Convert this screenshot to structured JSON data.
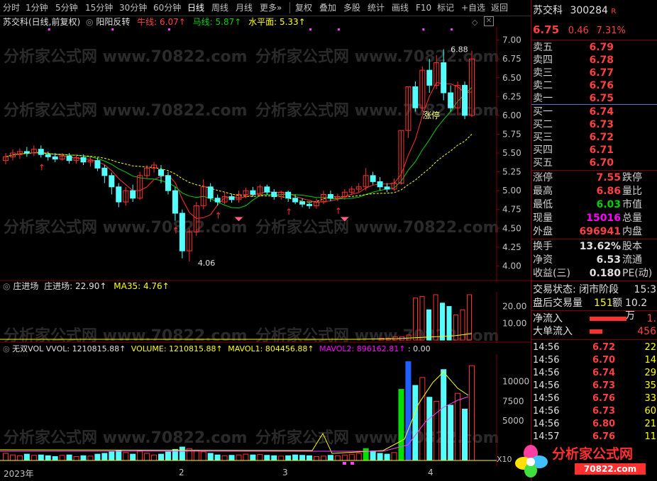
{
  "toolbar": {
    "items": [
      "分时",
      "1分钟",
      "5分钟",
      "15分钟",
      "30分钟",
      "60分钟",
      "日线",
      "周线",
      "月线",
      "更多»",
      "复权",
      "叠加",
      "多股",
      "统计",
      "画线",
      "F10",
      "标记",
      "+自选",
      "返回"
    ],
    "active": "日线"
  },
  "main_chart": {
    "title": "苏交科(日线,前复权)",
    "indicator_name": "阳阳反转",
    "niu_label": "牛线: 6.07↑",
    "ma_label": "马线: 5.87↑",
    "water_label": "水平面: 5.33↑",
    "y_ticks": [
      "7.00",
      "6.75",
      "6.50",
      "6.25",
      "6.00",
      "5.75",
      "5.50",
      "5.25",
      "5.00",
      "4.75",
      "4.50",
      "4.25",
      "4.00"
    ],
    "max_label": "6.88",
    "min_label": "4.06",
    "zhangting_label": "涨停",
    "candles": [
      [
        5.4,
        5.45,
        5.35,
        5.5
      ],
      [
        5.45,
        5.5,
        5.4,
        5.55
      ],
      [
        5.48,
        5.52,
        5.42,
        5.56
      ],
      [
        5.52,
        5.5,
        5.45,
        5.58
      ],
      [
        5.5,
        5.55,
        5.46,
        5.6
      ],
      [
        5.55,
        5.48,
        5.44,
        5.6
      ],
      [
        5.48,
        5.45,
        5.4,
        5.52
      ],
      [
        5.45,
        5.42,
        5.38,
        5.5
      ],
      [
        5.42,
        5.46,
        5.4,
        5.5
      ],
      [
        5.46,
        5.4,
        5.36,
        5.5
      ],
      [
        5.4,
        5.44,
        5.36,
        5.48
      ],
      [
        5.44,
        5.38,
        5.34,
        5.48
      ],
      [
        5.38,
        5.4,
        5.32,
        5.45
      ],
      [
        5.4,
        5.3,
        5.26,
        5.44
      ],
      [
        5.3,
        5.2,
        5.1,
        5.34
      ],
      [
        5.2,
        5.05,
        4.95,
        5.24
      ],
      [
        5.05,
        4.85,
        4.78,
        5.1
      ],
      [
        4.85,
        5.0,
        4.8,
        5.05
      ],
      [
        5.0,
        4.9,
        4.85,
        5.08
      ],
      [
        4.9,
        5.2,
        4.88,
        5.25
      ],
      [
        5.2,
        5.3,
        5.16,
        5.34
      ],
      [
        5.3,
        5.34,
        5.24,
        5.38
      ],
      [
        5.28,
        5.2,
        5.1,
        5.34
      ],
      [
        5.2,
        5.0,
        4.95,
        5.25
      ],
      [
        5.0,
        4.7,
        4.6,
        5.05
      ],
      [
        4.7,
        4.2,
        4.1,
        4.75
      ],
      [
        4.2,
        4.45,
        4.06,
        4.5
      ],
      [
        4.45,
        4.8,
        4.4,
        4.85
      ],
      [
        4.8,
        5.05,
        4.75,
        5.15
      ],
      [
        5.05,
        4.9,
        4.85,
        5.1
      ],
      [
        4.9,
        4.85,
        4.8,
        4.95
      ],
      [
        4.85,
        4.92,
        4.82,
        4.98
      ],
      [
        4.92,
        4.88,
        4.84,
        4.96
      ],
      [
        4.88,
        4.95,
        4.84,
        5.0
      ],
      [
        4.95,
        5.0,
        4.9,
        5.04
      ],
      [
        5.0,
        4.95,
        4.92,
        5.05
      ],
      [
        4.95,
        5.05,
        4.92,
        5.08
      ],
      [
        5.05,
        4.98,
        4.94,
        5.08
      ],
      [
        4.98,
        4.92,
        4.88,
        5.02
      ],
      [
        4.92,
        4.98,
        4.88,
        5.0
      ],
      [
        4.98,
        4.9,
        4.85,
        5.0
      ],
      [
        4.9,
        4.85,
        4.82,
        4.95
      ],
      [
        4.85,
        4.82,
        4.78,
        4.9
      ],
      [
        4.82,
        4.8,
        4.76,
        4.86
      ],
      [
        4.8,
        4.85,
        4.76,
        4.9
      ],
      [
        4.85,
        4.95,
        4.82,
        5.0
      ],
      [
        4.95,
        4.9,
        4.86,
        5.0
      ],
      [
        4.9,
        4.92,
        4.86,
        4.96
      ],
      [
        4.92,
        4.98,
        4.88,
        5.02
      ],
      [
        4.98,
        5.02,
        4.94,
        5.06
      ],
      [
        5.02,
        5.05,
        4.98,
        5.1
      ],
      [
        5.05,
        5.2,
        5.0,
        5.3
      ],
      [
        5.2,
        5.12,
        5.08,
        5.25
      ],
      [
        5.12,
        5.05,
        5.0,
        5.18
      ],
      [
        5.05,
        5.02,
        4.98,
        5.1
      ],
      [
        5.02,
        5.1,
        5.0,
        5.16
      ],
      [
        5.1,
        5.8,
        5.08,
        5.8
      ],
      [
        5.8,
        6.38,
        5.7,
        6.38
      ],
      [
        6.38,
        6.1,
        6.05,
        6.45
      ],
      [
        6.1,
        6.6,
        6.05,
        6.65
      ],
      [
        6.6,
        6.4,
        6.3,
        6.75
      ],
      [
        6.4,
        6.7,
        6.35,
        6.8
      ],
      [
        6.7,
        6.3,
        6.2,
        6.88
      ],
      [
        6.3,
        6.1,
        6.05,
        6.4
      ],
      [
        6.1,
        6.4,
        6.0,
        6.45
      ],
      [
        6.4,
        6.0,
        5.95,
        6.45
      ],
      [
        6.0,
        6.75,
        5.98,
        6.86
      ]
    ]
  },
  "zjc": {
    "title": "庄进场",
    "value_label": "庄进场: 22.90↑",
    "ma35_label": "MA35: 4.76↑",
    "y_ticks": [
      "20.00",
      "10.00"
    ]
  },
  "vol": {
    "title": "无双VOL",
    "vvol_label": "VVOL: 1210815.88↑",
    "volume_label": "VOLUME: 1210815.88↑",
    "mavol1_label": "MAVOL1: 804456.88↑",
    "mavol2_label": "MAVOL2: 896162.81↑",
    "extra_label": ": 0.00",
    "y_ticks": [
      "10000",
      "7500",
      "5000"
    ],
    "x_unit": "X10"
  },
  "xaxis": {
    "labels": [
      "2023年",
      "2",
      "3",
      "4"
    ]
  },
  "quote": {
    "name": "苏交科",
    "code": "300284",
    "badge": "R",
    "price": "6.75",
    "change": "0.46",
    "pct": "7.31%",
    "asks": [
      [
        "卖五",
        "6.79"
      ],
      [
        "卖四",
        "6.78"
      ],
      [
        "卖三",
        "6.77"
      ],
      [
        "卖二",
        "6.76"
      ],
      [
        "卖一",
        "6.75"
      ]
    ],
    "bids": [
      [
        "买一",
        "6.74"
      ],
      [
        "买二",
        "6.73"
      ],
      [
        "买三",
        "6.72"
      ],
      [
        "买四",
        "6.71"
      ],
      [
        "买五",
        "6.70"
      ]
    ],
    "stats": [
      {
        "l": "涨停",
        "v": "7.55",
        "r": "跌停"
      },
      {
        "l": "最高",
        "v": "6.86",
        "r": "量比"
      },
      {
        "l": "最低",
        "v": "6.03",
        "r": "市值"
      },
      {
        "l": "现量",
        "v": "15016",
        "r": "总量"
      },
      {
        "l": "外盘",
        "v": "696941",
        "r": "内盘"
      }
    ],
    "fin": [
      {
        "l": "换手",
        "v": "13.62%",
        "r": "股本"
      },
      {
        "l": "净资",
        "v": "6.53",
        "r": "流通"
      },
      {
        "l": "收益(三)",
        "v": "0.180",
        "r": "PE(动)"
      }
    ],
    "trade_state": "交易状态: 闭市阶段",
    "trade_time": "15:3",
    "after_hours": "盘后交易量",
    "after_vol": "151",
    "after_amt_l": "额",
    "after_amt": "10.2万",
    "net_inflow": "净流入",
    "net_inflow_v": "1.",
    "big_inflow": "大单流入",
    "big_inflow_v": "456",
    "ticks": [
      [
        "14:56",
        "6.72",
        "22"
      ],
      [
        "14:56",
        "6.70",
        "14"
      ],
      [
        "14:56",
        "6.74",
        "29"
      ],
      [
        "14:56",
        "6.73",
        "35"
      ],
      [
        "14:56",
        "6.76",
        "33"
      ],
      [
        "14:56",
        "6.73",
        "60"
      ],
      [
        "14:56",
        "6.80",
        "21"
      ],
      [
        "14:57",
        "6.76",
        "11"
      ]
    ]
  },
  "watermark": "分析家公式网 www.70822.com",
  "logo": {
    "text": "分析家公式网",
    "url": "70822.com"
  }
}
